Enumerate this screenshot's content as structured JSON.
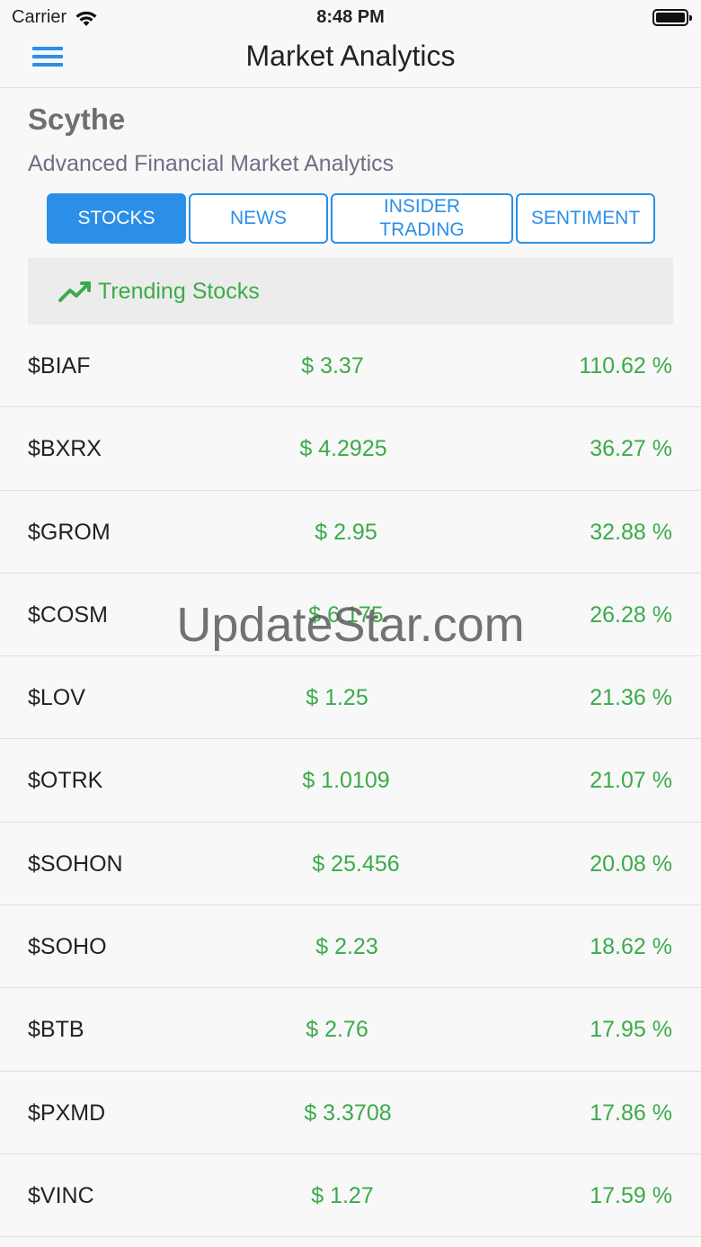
{
  "status_bar": {
    "carrier": "Carrier",
    "time": "8:48 PM"
  },
  "nav": {
    "title": "Market Analytics"
  },
  "app": {
    "brand": "Scythe",
    "subtitle": "Advanced Financial Market Analytics"
  },
  "tabs": [
    {
      "label": "STOCKS",
      "active": true
    },
    {
      "label": "NEWS",
      "active": false
    },
    {
      "label": "INSIDER TRADING",
      "active": false
    },
    {
      "label": "SENTIMENT",
      "active": false
    }
  ],
  "section": {
    "title": "Trending Stocks"
  },
  "stocks": [
    {
      "symbol": "$BIAF",
      "price": "$ 3.37",
      "change": "110.62 %"
    },
    {
      "symbol": "$BXRX",
      "price": "$ 4.2925",
      "change": "36.27 %"
    },
    {
      "symbol": "$GROM",
      "price": "$ 2.95",
      "change": "32.88 %"
    },
    {
      "symbol": "$COSM",
      "price": "$ 6.175",
      "change": "26.28 %"
    },
    {
      "symbol": "$LOV",
      "price": "$ 1.25",
      "change": "21.36 %"
    },
    {
      "symbol": "$OTRK",
      "price": "$ 1.0109",
      "change": "21.07 %"
    },
    {
      "symbol": "$SOHON",
      "price": "$ 25.456",
      "change": "20.08 %"
    },
    {
      "symbol": "$SOHO",
      "price": "$ 2.23",
      "change": "18.62 %"
    },
    {
      "symbol": "$BTB",
      "price": "$ 2.76",
      "change": "17.95 %"
    },
    {
      "symbol": "$PXMD",
      "price": "$ 3.3708",
      "change": "17.86 %"
    },
    {
      "symbol": "$VINC",
      "price": "$ 1.27",
      "change": "17.59 %"
    }
  ],
  "watermark": "UpdateStar.com",
  "colors": {
    "accent": "#2b8fe8",
    "positive": "#3bab49"
  }
}
